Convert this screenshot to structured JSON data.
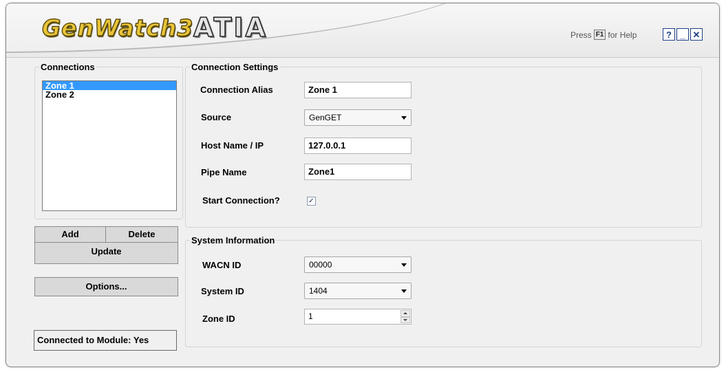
{
  "branding": {
    "logo_left": "GenWatch3",
    "logo_right": "ATIA"
  },
  "help": {
    "press": "Press",
    "key": "F1",
    "suffix": "for Help"
  },
  "window_buttons": {
    "help": "?",
    "minimize": "_",
    "close": "✕"
  },
  "connections": {
    "title": "Connections",
    "items": [
      {
        "label": "Zone 1",
        "selected": true
      },
      {
        "label": "Zone 2",
        "selected": false
      }
    ]
  },
  "buttons": {
    "add": "Add",
    "delete": "Delete",
    "update": "Update",
    "options": "Options..."
  },
  "status": {
    "text": "Connected to Module: Yes"
  },
  "connection_settings": {
    "title": "Connection Settings",
    "alias_label": "Connection Alias",
    "alias_value": "Zone 1",
    "source_label": "Source",
    "source_value": "GenGET",
    "host_label": "Host Name / IP",
    "host_value": "127.0.0.1",
    "pipe_label": "Pipe Name",
    "pipe_value": "Zone1",
    "start_label": "Start Connection?",
    "start_checked": true
  },
  "system_information": {
    "title": "System Information",
    "wacn_label": "WACN ID",
    "wacn_value": "00000",
    "system_label": "System ID",
    "system_value": "1404",
    "zone_label": "Zone ID",
    "zone_value": "1"
  },
  "colors": {
    "selection": "#3399ff",
    "window_button": "#1f3f87",
    "logo_gold": "#e8c437"
  }
}
